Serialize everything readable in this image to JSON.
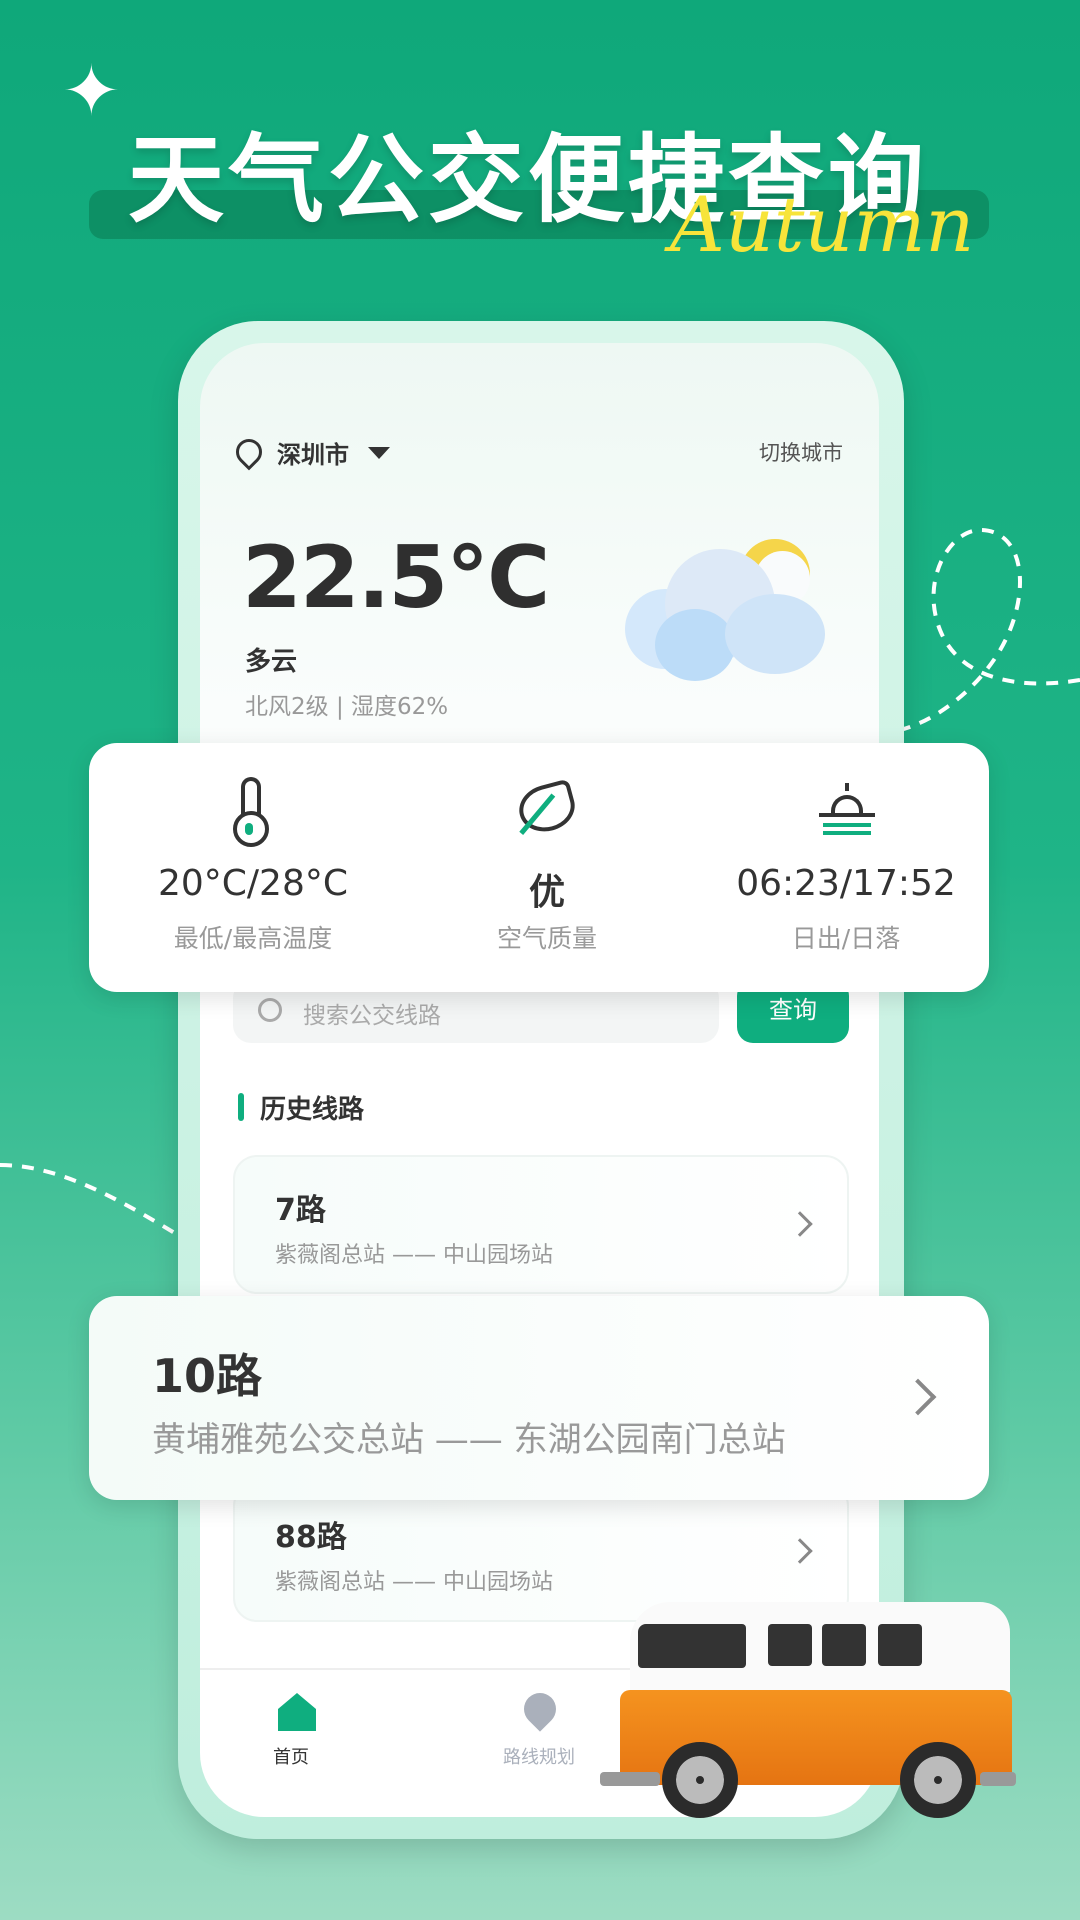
{
  "banner": {
    "title": "天气公交便捷查询",
    "script_word": "Autumn"
  },
  "location": {
    "city": "深圳市",
    "switch_label": "切换城市"
  },
  "weather": {
    "temperature": "22.5°C",
    "condition": "多云",
    "detail": "北风2级 | 湿度62%",
    "icon": "cloud-moon-icon"
  },
  "stats": [
    {
      "icon": "thermometer-icon",
      "value": "20°C/28°C",
      "label": "最低/最高温度"
    },
    {
      "icon": "leaf-icon",
      "value": "优",
      "label": "空气质量"
    },
    {
      "icon": "sunrise-icon",
      "value": "06:23/17:52",
      "label": "日出/日落"
    }
  ],
  "search": {
    "placeholder": "搜索公交线路",
    "button": "查询"
  },
  "history": {
    "title": "历史线路",
    "routes": [
      {
        "name": "7路",
        "stops": "紫薇阁总站 —— 中山园场站"
      },
      {
        "name": "10路",
        "stops": "黄埔雅苑公交总站 —— 东湖公园南门总站"
      },
      {
        "name": "88路",
        "stops": "紫薇阁总站 —— 中山园场站"
      }
    ]
  },
  "tabs": [
    {
      "label": "首页",
      "icon": "home-icon",
      "active": true
    },
    {
      "label": "路线规划",
      "icon": "route-icon",
      "active": false
    }
  ],
  "colors": {
    "accent": "#0fae7f",
    "sun": "#f5d54a",
    "bus": "#f08a1e"
  }
}
